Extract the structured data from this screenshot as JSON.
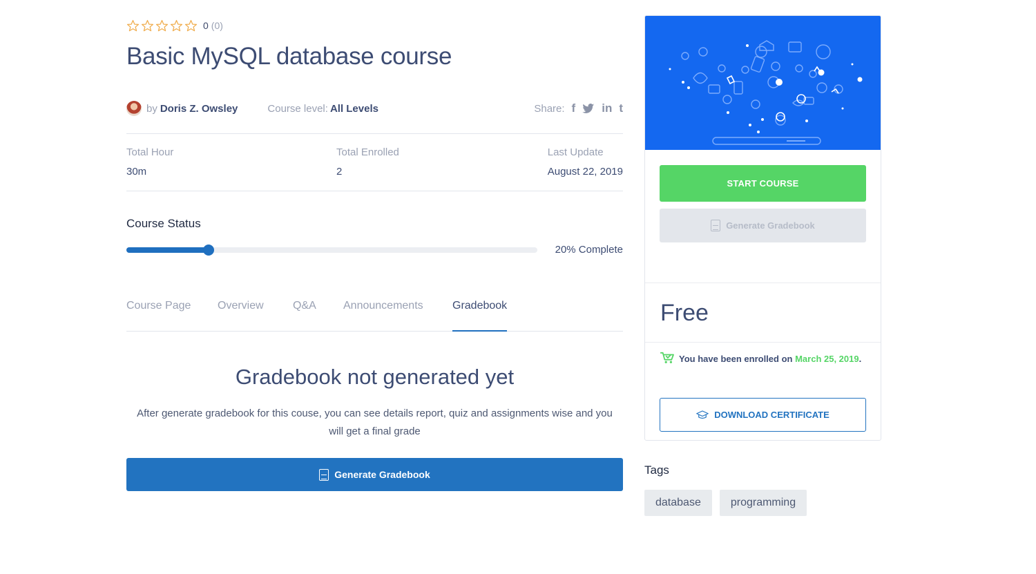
{
  "rating": {
    "value": "0",
    "count": "(0)",
    "stars": 5,
    "star_color": "#f0ad4e"
  },
  "course": {
    "title": "Basic MySQL database course",
    "by_label": "by",
    "author": "Doris Z. Owsley",
    "level_label": "Course level:",
    "level_value": "All Levels",
    "share_label": "Share:",
    "share_icons": [
      "facebook-icon",
      "twitter-icon",
      "linkedin-icon",
      "tumblr-icon"
    ]
  },
  "stats": [
    {
      "label": "Total Hour",
      "value": "30m"
    },
    {
      "label": "Total Enrolled",
      "value": "2"
    },
    {
      "label": "Last Update",
      "value": "August 22, 2019"
    }
  ],
  "status": {
    "title": "Course Status",
    "progress_fraction": 0.2,
    "progress_text": "20% Complete",
    "accent": "#1f6fbf"
  },
  "tabs": [
    {
      "label": "Course Page",
      "active": false
    },
    {
      "label": "Overview",
      "active": false
    },
    {
      "label": "Q&A",
      "active": false
    },
    {
      "label": "Announcements",
      "active": false
    },
    {
      "label": "Gradebook",
      "active": true
    }
  ],
  "gradebook": {
    "title": "Gradebook not generated yet",
    "description": "After generate gradebook for this couse, you can see details report, quiz and assignments wise and you will get a final grade",
    "button_label": "Generate Gradebook",
    "button_color": "#2273c0"
  },
  "sidebar": {
    "start_label": "START COURSE",
    "start_color": "#55d566",
    "generate_label": "Generate Gradebook",
    "price": "Free",
    "enrolled_text": "You have been enrolled on",
    "enrolled_date": "March 25, 2019",
    "enrolled_end": ".",
    "certificate_label": "DOWNLOAD CERTIFICATE",
    "hero_color": "#1468f0"
  },
  "tags": {
    "title": "Tags",
    "items": [
      "database",
      "programming"
    ]
  }
}
